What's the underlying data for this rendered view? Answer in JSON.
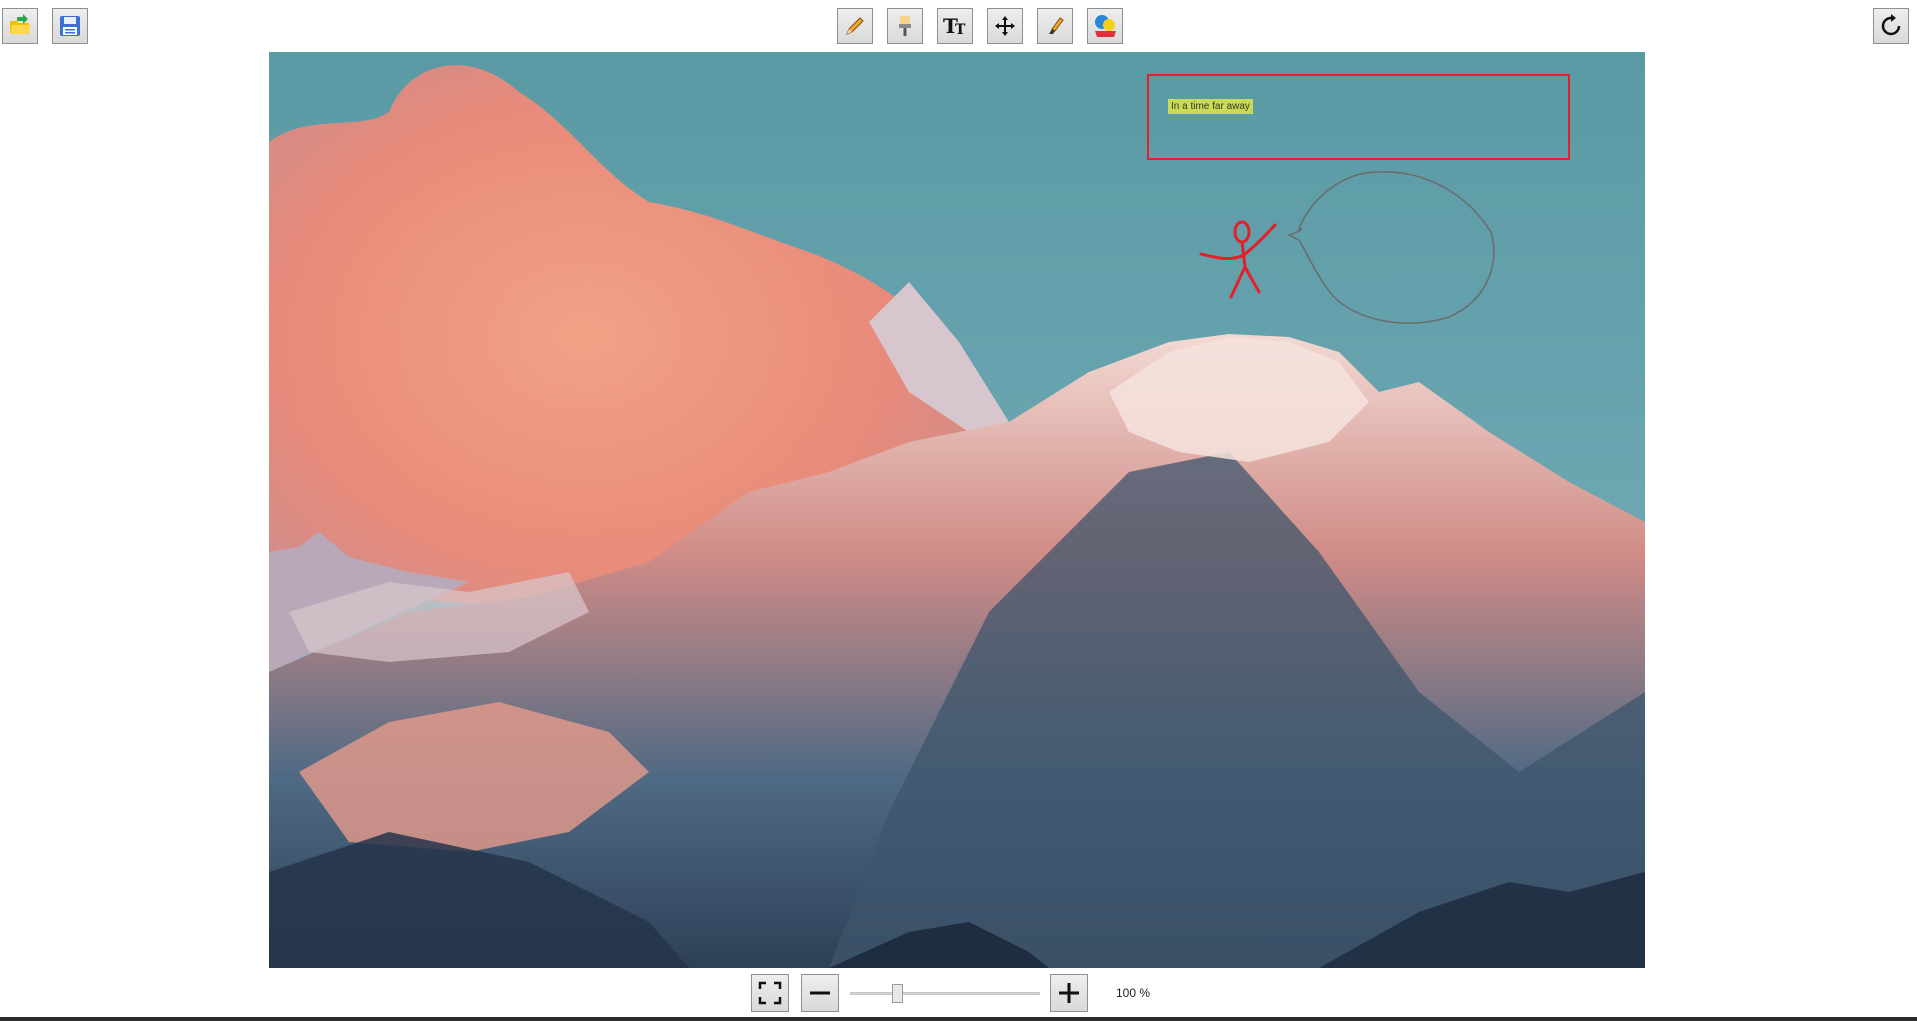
{
  "toolbar": {
    "left": [
      {
        "name": "open-button",
        "icon": "open-folder-icon",
        "title": "Open"
      },
      {
        "name": "save-button",
        "icon": "floppy-disk-icon",
        "title": "Save"
      }
    ],
    "tools": [
      {
        "name": "pencil-tool-button",
        "icon": "pencil-icon"
      },
      {
        "name": "brush-tool-button",
        "icon": "paintbrush-icon"
      },
      {
        "name": "text-tool-button",
        "icon": "text-icon"
      },
      {
        "name": "move-tool-button",
        "icon": "move-arrows-icon"
      },
      {
        "name": "highlighter-tool-button",
        "icon": "highlighter-icon"
      },
      {
        "name": "color-tool-button",
        "icon": "color-palette-icon"
      }
    ],
    "right": [
      {
        "name": "reset-button",
        "icon": "rotate-icon"
      }
    ]
  },
  "canvas": {
    "annotation_text": "In a time far away",
    "annotation_colors": {
      "rectangle": "#e3202a",
      "stick_figure": "#e3202a",
      "speech_bubble": "#6b6b6b",
      "text_highlight": "#ebf03c"
    }
  },
  "zoom": {
    "fit_icon": "fit-screen-icon",
    "zoom_out_icon": "minus-icon",
    "zoom_in_icon": "plus-icon",
    "level_label": "100 %",
    "slider_fraction": 0.25
  },
  "colors": {
    "sky": "#5a9aa4",
    "cloud": "#f3907a",
    "snow": "#f2e0dc",
    "rock": "#3e566c"
  }
}
